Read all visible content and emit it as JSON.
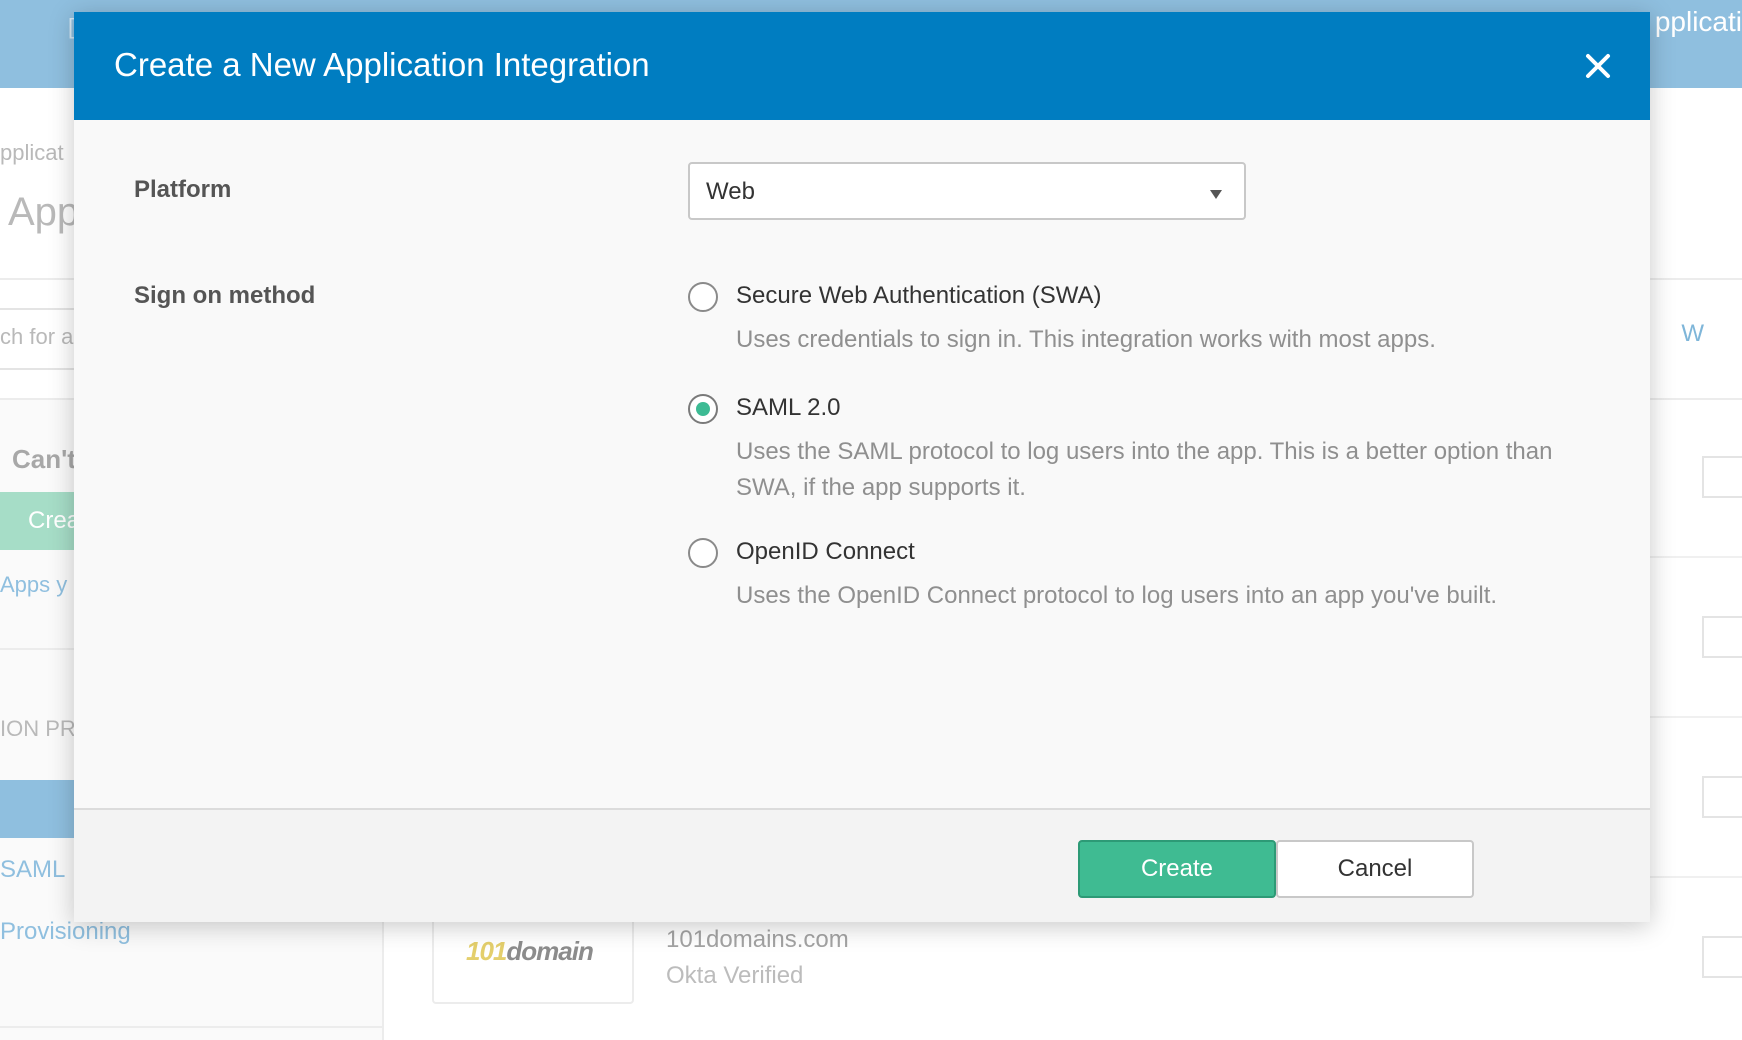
{
  "background": {
    "top_bar_fragment": "pplicati",
    "breadcrumb_fragment": "pplicat",
    "title_fragment": "App",
    "search_fragment": "ch for a",
    "alpha_letters": "V W",
    "cant_fragment": "Can't",
    "create_fragment": "Crea",
    "apps_link_fragment": "Apps y",
    "section_fragment": "ION PR",
    "saml_link": "SAML",
    "provisioning_link": "Provisioning",
    "app_logo_num": "101",
    "app_logo_word": "domain",
    "app_name": "101domains.com",
    "app_status": "Okta Verified"
  },
  "modal": {
    "title": "Create a New Application Integration",
    "platform_label": "Platform",
    "platform_value": "Web",
    "signon_label": "Sign on method",
    "options": [
      {
        "label": "Secure Web Authentication (SWA)",
        "description": "Uses credentials to sign in. This integration works with most apps.",
        "selected": false
      },
      {
        "label": "SAML 2.0",
        "description": "Uses the SAML protocol to log users into the app. This is a better option than SWA, if the app supports it.",
        "selected": true
      },
      {
        "label": "OpenID Connect",
        "description": "Uses the OpenID Connect protocol to log users into an app you've built.",
        "selected": false
      }
    ],
    "create_label": "Create",
    "cancel_label": "Cancel"
  },
  "colors": {
    "header_blue": "#007dc1",
    "accent_green": "#3fbb92"
  }
}
